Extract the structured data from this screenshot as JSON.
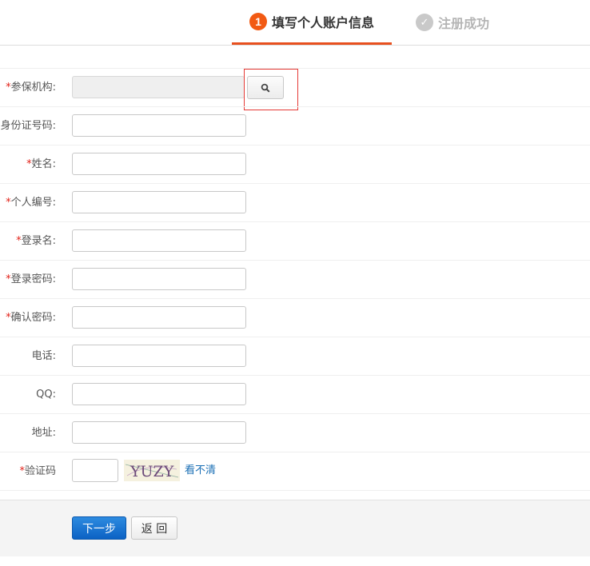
{
  "steps": [
    {
      "number": "1",
      "label": "填写个人账户信息",
      "state": "active"
    },
    {
      "icon": "check-icon",
      "label": "注册成功",
      "state": "pending"
    }
  ],
  "form": {
    "fields": [
      {
        "required": "*",
        "label": "参保机构:",
        "type": "search",
        "disabled": true,
        "value": ""
      },
      {
        "required": "",
        "label": "身份证号码:",
        "type": "text",
        "value": ""
      },
      {
        "required": "*",
        "label": "姓名:",
        "type": "text",
        "value": ""
      },
      {
        "required": "*",
        "label": "个人编号:",
        "type": "text",
        "value": ""
      },
      {
        "required": "*",
        "label": "登录名:",
        "type": "text",
        "value": ""
      },
      {
        "required": "*",
        "label": "登录密码:",
        "type": "password",
        "value": ""
      },
      {
        "required": "*",
        "label": "确认密码:",
        "type": "password",
        "value": ""
      },
      {
        "required": "",
        "label": "电话:",
        "type": "text",
        "value": ""
      },
      {
        "required": "",
        "label": "QQ:",
        "type": "text",
        "value": ""
      },
      {
        "required": "",
        "label": "地址:",
        "type": "text",
        "value": ""
      }
    ],
    "captcha": {
      "required": "*",
      "label": "验证码",
      "image_text": "YUZY",
      "refresh_link": "看不清"
    }
  },
  "footer": {
    "next_label": "下一步",
    "back_label": "返 回"
  },
  "colors": {
    "accent": "#f25a13",
    "required": "#e2231a",
    "primary_button": "#1670cf",
    "link": "#1a6fb5"
  }
}
